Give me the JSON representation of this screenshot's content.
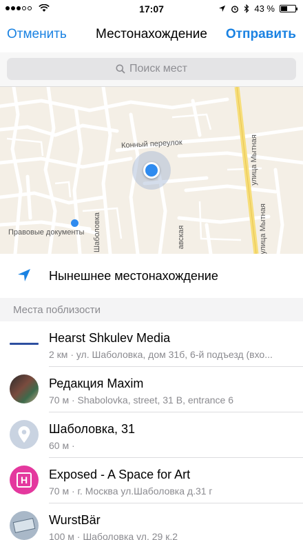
{
  "status_bar": {
    "time": "17:07",
    "battery_text": "43 %",
    "battery_level": 0.43,
    "signal_bars_filled": 3,
    "signal_bars_total": 5
  },
  "nav": {
    "cancel": "Отменить",
    "title": "Местонахождение",
    "send": "Отправить"
  },
  "search": {
    "placeholder": "Поиск мест"
  },
  "map": {
    "labels": {
      "street1": "Конный переулок",
      "street2": "улица Мытная",
      "street3": "улица Мытная",
      "poi": "Правовые документы",
      "street4": "Шаболовка",
      "street5": "авская"
    }
  },
  "current_location": {
    "label": "Нынешнее местонахождение"
  },
  "nearby": {
    "header": "Места поблизости",
    "items": [
      {
        "name": "Hearst Shkulev Media",
        "sub": "2 км · ул. Шаболовка, дом 31б,  6-й подъезд (вхо..."
      },
      {
        "name": "Редакция Maxim",
        "sub": "70 м · Shabolovka, street, 31 B, entrance 6"
      },
      {
        "name": "Шаболовка, 31",
        "sub": "60 м ·"
      },
      {
        "name": "Exposed - A Space for Art",
        "sub": "70 м · г. Москва ул.Шаболовка д.31 г"
      },
      {
        "name": "WurstBär",
        "sub": "100 м · Шаболовка ул. 29 к.2"
      }
    ]
  },
  "colors": {
    "accent": "#1a82e2",
    "pin": "#2f8bef",
    "exposed_icon": "#e4389e"
  }
}
